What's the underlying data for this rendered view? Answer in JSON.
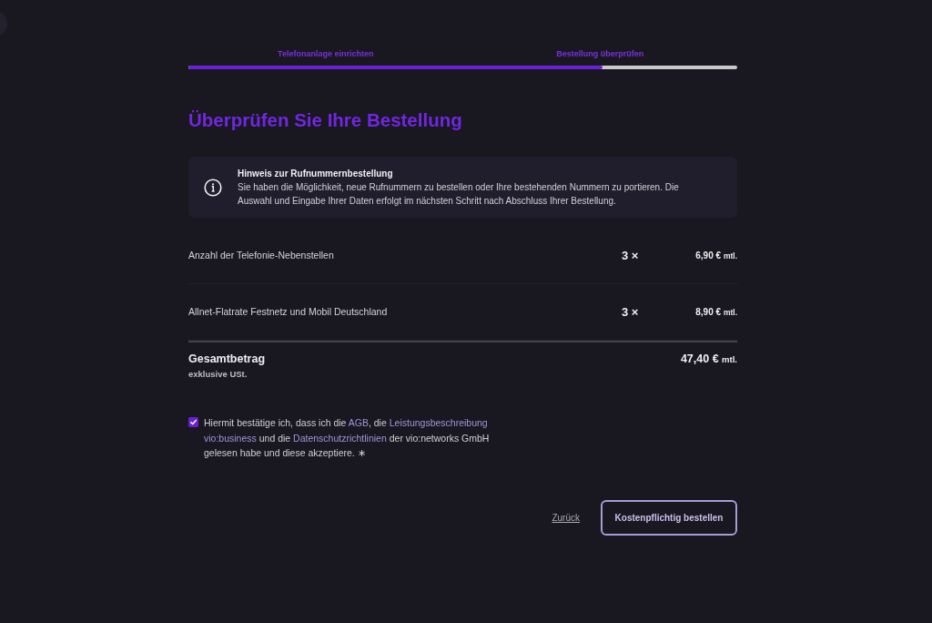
{
  "progress": {
    "steps": [
      {
        "label": "Telefonanlage einrichten"
      },
      {
        "label": "Bestellung überprüfen"
      }
    ],
    "level": 0.755
  },
  "heading": "Überprüfen Sie Ihre Bestellung",
  "notice": {
    "title": "Hinweis zur Rufnummernbestellung",
    "text": "Sie haben die Möglichkeit, neue Rufnummern zu bestellen oder Ihre bestehenden Nummern zu portieren. Die Auswahl und Eingabe Ihrer Daten erfolgt im nächsten Schritt nach Abschluss Ihrer Bestellung."
  },
  "items": [
    {
      "name": "Anzahl der Telefonie-Nebenstellen",
      "quantity": "3 ×",
      "price": "6,90 €",
      "unit": "mtl."
    },
    {
      "name": "Allnet-Flatrate Festnetz und Mobil Deutschland",
      "quantity": "3 ×",
      "price": "8,90 €",
      "unit": "mtl."
    }
  ],
  "total": {
    "label": "Gesamtbetrag",
    "note": "exklusive USt.",
    "price": "47,40 €",
    "unit": "mtl."
  },
  "consent": {
    "checked": true,
    "parts": [
      {
        "kind": "text",
        "text": "Hiermit bestätige ich, dass ich die "
      },
      {
        "kind": "link",
        "text": "AGB"
      },
      {
        "kind": "text",
        "text": ", die "
      },
      {
        "kind": "link",
        "text": "Leistungsbeschreibung"
      },
      {
        "kind": "link",
        "text": "vio:business"
      },
      {
        "kind": "text",
        "text": " und die "
      },
      {
        "kind": "link",
        "text": "Datenschutzrichtlinien"
      },
      {
        "kind": "text",
        "text": " der vio:networks GmbH gelesen habe und diese akzeptiere. "
      }
    ],
    "required_mark": "∗"
  },
  "actions": {
    "back": "Zurück",
    "submit": "Kostenpflichtig bestellen"
  }
}
